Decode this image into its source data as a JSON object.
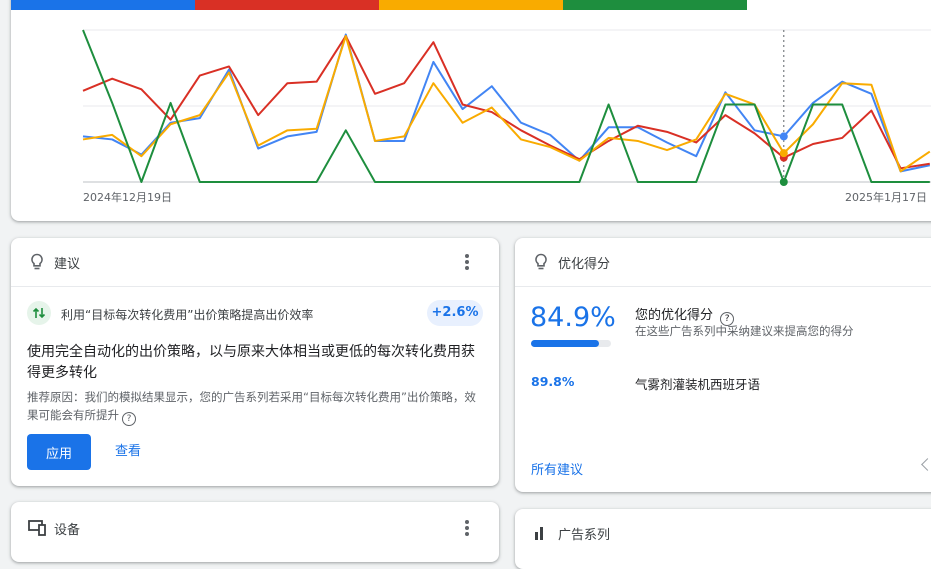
{
  "colors": {
    "blue": "#1a73e8",
    "red": "#d93025",
    "yellow": "#f9ab00",
    "green": "#1e8e3e"
  },
  "chart_data": {
    "type": "line",
    "x_tick_labels": [
      "2024年12月19日",
      "2025年1月17日"
    ],
    "series": [
      {
        "color": "#4285f4",
        "values": [
          0.3,
          0.28,
          0.18,
          0.39,
          0.42,
          0.74,
          0.22,
          0.3,
          0.33,
          0.97,
          0.27,
          0.27,
          0.79,
          0.48,
          0.63,
          0.39,
          0.31,
          0.14,
          0.36,
          0.36,
          0.26,
          0.17,
          0.59,
          0.34,
          0.3,
          0.52,
          0.66,
          0.58,
          0.07,
          0.11
        ]
      },
      {
        "color": "#d93025",
        "values": [
          0.6,
          0.68,
          0.61,
          0.41,
          0.7,
          0.76,
          0.44,
          0.65,
          0.66,
          0.96,
          0.58,
          0.65,
          0.92,
          0.51,
          0.46,
          0.34,
          0.24,
          0.15,
          0.27,
          0.37,
          0.33,
          0.26,
          0.44,
          0.32,
          0.16,
          0.25,
          0.29,
          0.47,
          0.09,
          0.12
        ]
      },
      {
        "color": "#f9ab00",
        "values": [
          0.28,
          0.31,
          0.17,
          0.38,
          0.44,
          0.72,
          0.24,
          0.34,
          0.35,
          0.96,
          0.27,
          0.3,
          0.65,
          0.39,
          0.49,
          0.28,
          0.23,
          0.14,
          0.29,
          0.27,
          0.21,
          0.28,
          0.58,
          0.51,
          0.19,
          0.38,
          0.65,
          0.64,
          0.07,
          0.2
        ]
      },
      {
        "color": "#1e8e3e",
        "values": [
          1.0,
          0.52,
          0.0,
          0.52,
          0.0,
          0.0,
          0.0,
          0.0,
          0.0,
          0.34,
          0.0,
          0.0,
          0.0,
          0.0,
          0.0,
          0.0,
          0.0,
          0.0,
          0.51,
          0.0,
          0.0,
          0.0,
          0.51,
          0.51,
          0.0,
          0.51,
          0.51,
          0.0,
          0.0,
          0.0
        ]
      }
    ],
    "highlight_index": 24,
    "legend_strip": [
      "#1a73e8",
      "#d93025",
      "#f9ab00",
      "#1e8e3e"
    ]
  },
  "recommendation": {
    "title": "建议",
    "item_label": "利用“目标每次转化费用”出价策略提高出价效率",
    "uplift": "+2.6%",
    "headline": "使用完全自动化的出价策略，以与原来大体相当或更低的每次转化费用获得更多转化",
    "reason": "推荐原因：我们的模拟结果显示，您的广告系列若采用“目标每次转化费用”出价策略，效果可能会有所提升",
    "apply_label": "应用",
    "view_label": "查看"
  },
  "optimization": {
    "title": "优化得分",
    "score": "84.9%",
    "score_fraction": 0.849,
    "label": "您的优化得分",
    "description": "在这些广告系列中采纳建议来提高您的得分",
    "campaign_score": "89.8%",
    "campaign_name": "气雾剂灌装机西班牙语",
    "all_link": "所有建议"
  },
  "devices": {
    "title": "设备"
  },
  "campaigns": {
    "title": "广告系列"
  }
}
